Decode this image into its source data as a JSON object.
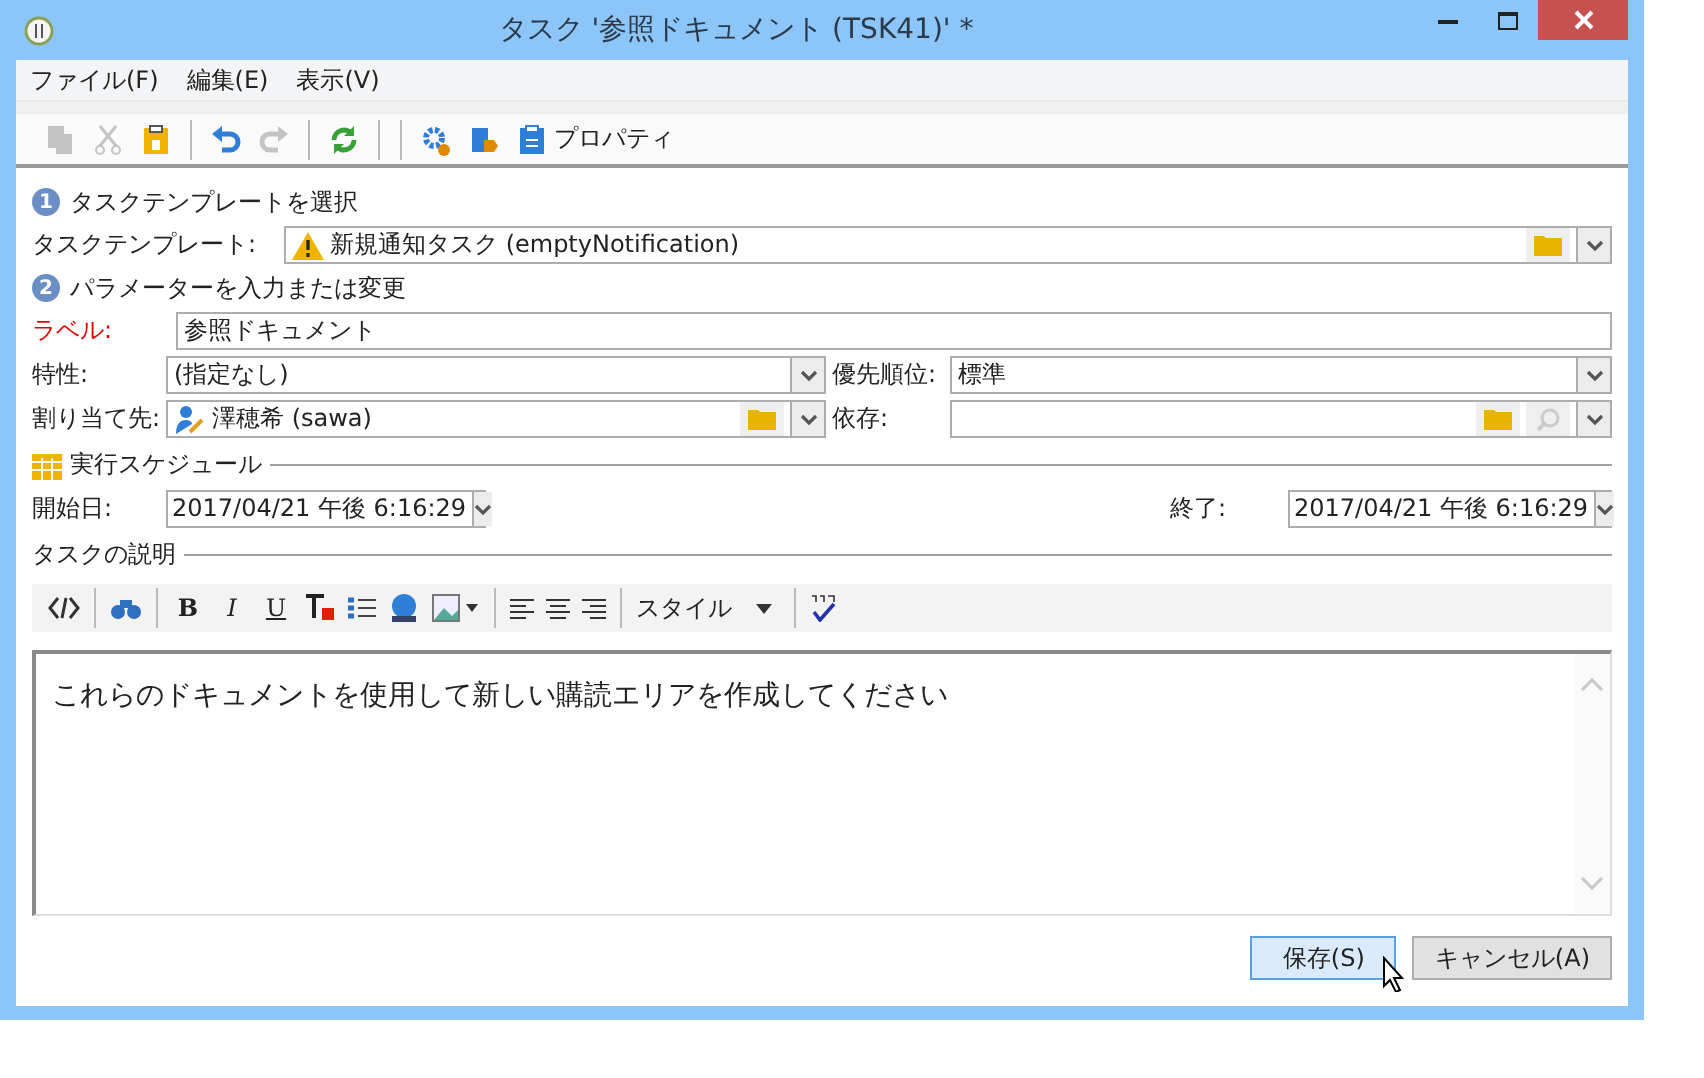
{
  "window": {
    "title": "タスク '参照ドキュメント (TSK41)' *"
  },
  "menu": [
    {
      "label": "ファイル(F)"
    },
    {
      "label": "編集(E)"
    },
    {
      "label": "表示(V)"
    }
  ],
  "toolbar": [
    {
      "disabled": true
    },
    {
      "disabled": true
    },
    {
      "disabled": false
    },
    {
      "disabled": false
    },
    {
      "disabled": true
    },
    {
      "disabled": false
    },
    {
      "disabled": false
    },
    {
      "disabled": false
    },
    {
      "disabled": false,
      "label": "プロパティ"
    }
  ],
  "step1": {
    "number": "1",
    "title": "タスクテンプレートを選択"
  },
  "template": {
    "label": "タスクテンプレート:",
    "value": "新規通知タスク (emptyNotification)"
  },
  "step2": {
    "number": "2",
    "title": "パラメーターを入力または変更"
  },
  "label_field": {
    "label": "ラベル:",
    "value": "参照ドキュメント",
    "required": true
  },
  "nature": {
    "label": "特性:",
    "value": "(指定なし)"
  },
  "priority": {
    "label": "優先順位:",
    "value": "標準"
  },
  "assignee": {
    "label": "割り当て先:",
    "value": "澤穂希 (sawa)"
  },
  "depends": {
    "label": "依存:"
  },
  "schedule": {
    "title": "実行スケジュール",
    "start_label": "開始日:",
    "start": "2017/04/21 午後 6:16:29",
    "end_label": "終了:",
    "end": "2017/04/21 午後 6:16:29"
  },
  "description": {
    "title": "タスクの説明",
    "format_buttons": [
      "B",
      "I",
      "U"
    ],
    "style_label": "スタイル",
    "text": "これらのドキュメントを使用して新しい購読エリアを作成してください"
  },
  "buttons": [
    {
      "label": "保存(S)",
      "focused": true
    },
    {
      "label": "キャンセル(A)",
      "focused": false
    }
  ]
}
